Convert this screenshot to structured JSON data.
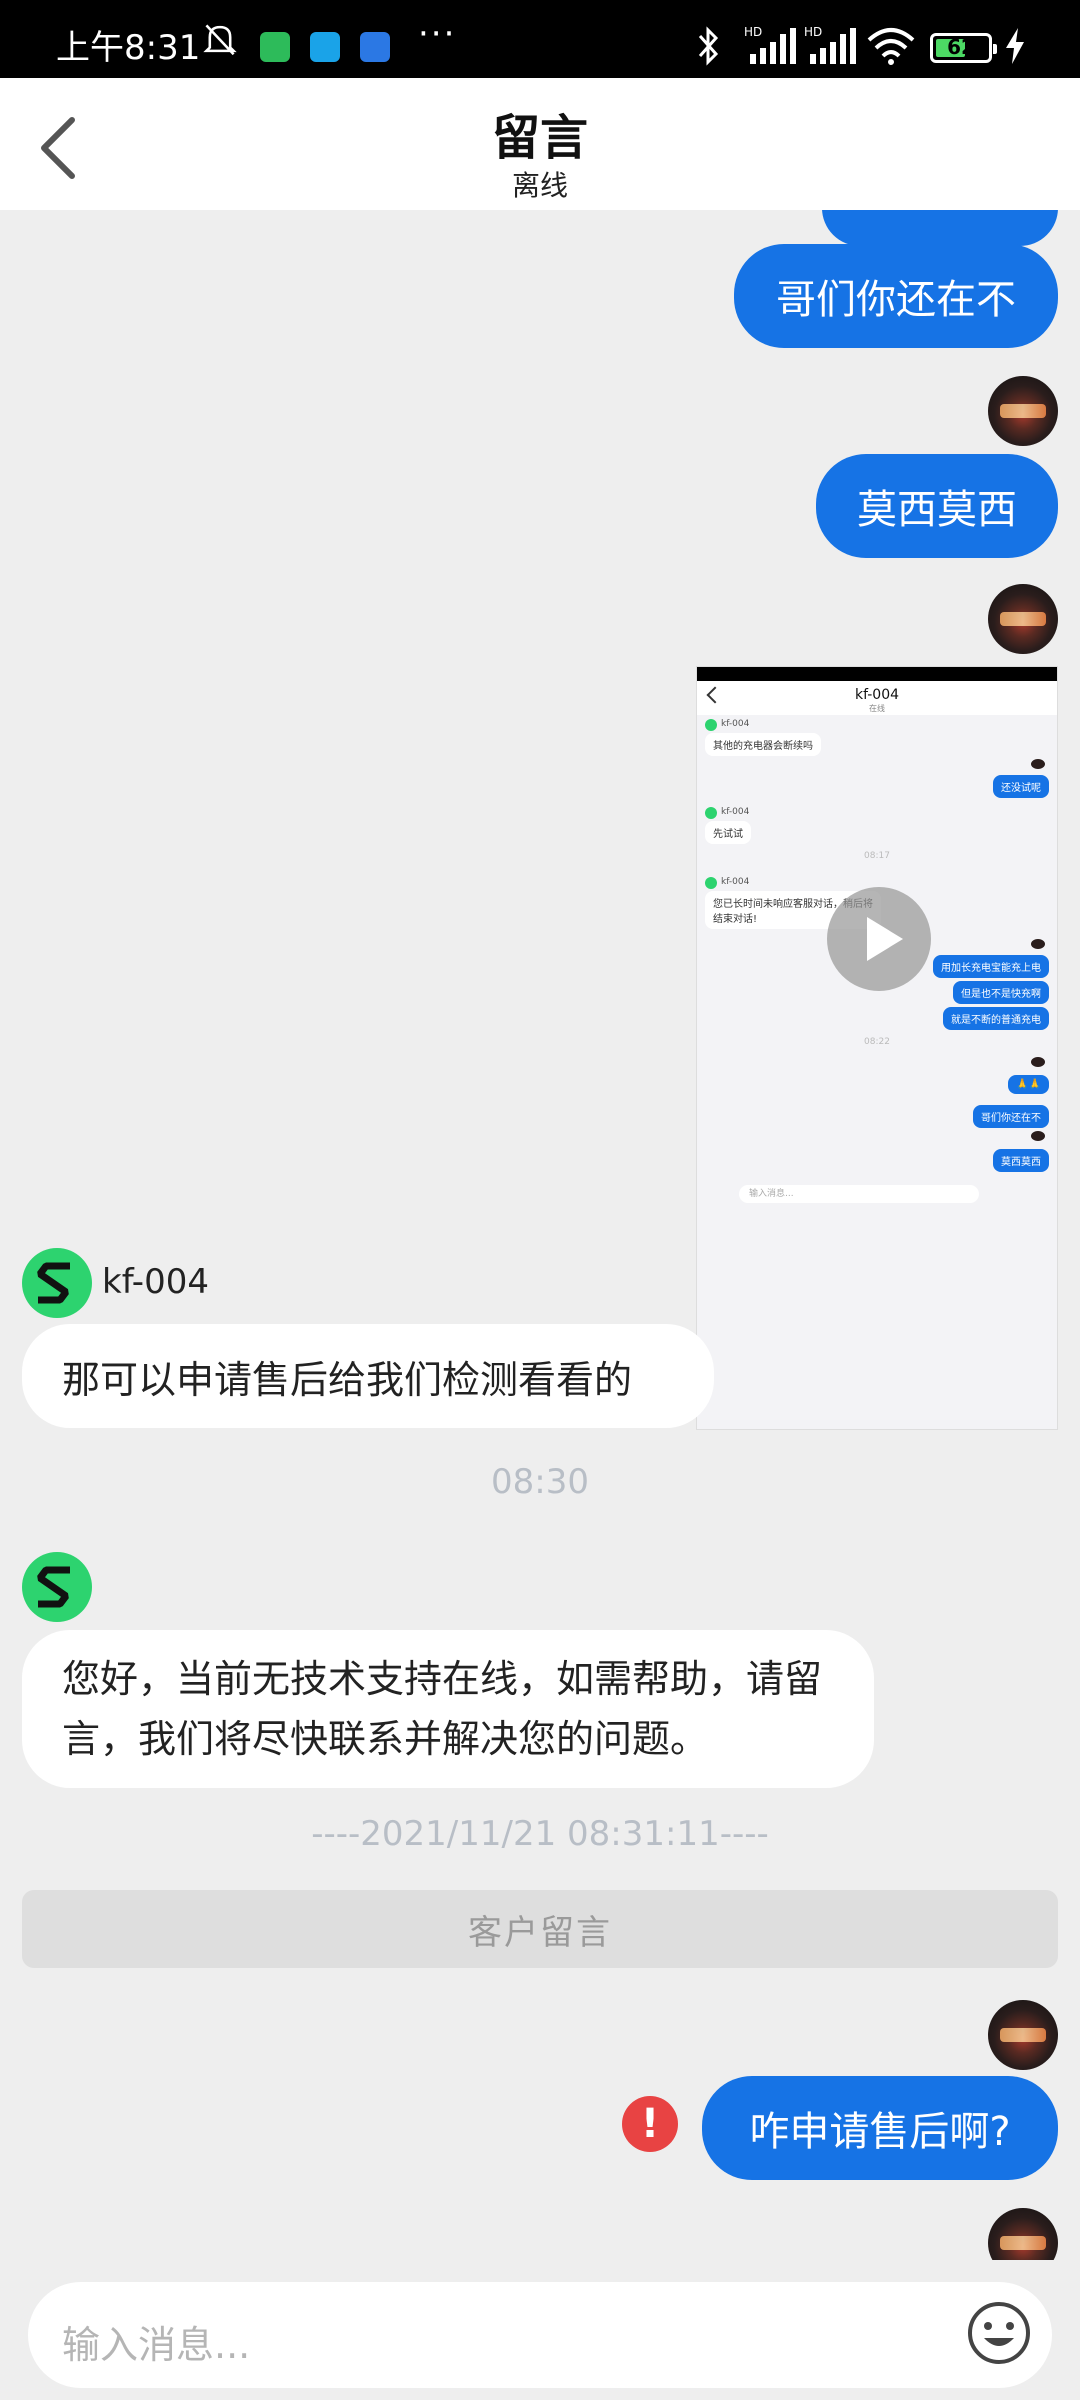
{
  "status_bar": {
    "time": "上午8:31",
    "more": "···",
    "battery": "62",
    "battery_level_percent": 62
  },
  "header": {
    "title": "留言",
    "subtitle": "离线"
  },
  "messages": {
    "out_1": "哥们你还在不",
    "out_2": "莫西莫西",
    "agent_name_1": "kf-004",
    "in_1": "那可以申请售后给我们检测看看的",
    "time_1": "08:30",
    "in_2": "您好，当前无技术支持在线，如需帮助，请留言，我们将尽快联系并解决您的问题。",
    "divider_time": "----2021/11/21 08:31:11----",
    "leave_message_bar": "客户留言",
    "out_3": "咋申请售后啊?",
    "error_mark": "!"
  },
  "video_thumbnail": {
    "title": "kf-004",
    "subtitle": "在线",
    "agent": "kf-004",
    "in_a": "其他的充电器会断续吗",
    "out_a": "还没试呢",
    "in_b": "先试试",
    "ts_a": "08:17",
    "in_c": "您已长时间未响应客服对话，稍后将结束对话!",
    "out_b": "用加长充电宝能充上电",
    "out_c": "但是也不是快充啊",
    "out_d": "就是不断的普通充电",
    "ts_b": "08:22",
    "out_e": "🙏🙏",
    "out_f": "哥们你还在不",
    "out_g": "莫西莫西",
    "input_placeholder": "输入消息..."
  },
  "input": {
    "placeholder": "输入消息..."
  },
  "colors": {
    "bubble_out": "#1673e5",
    "agent_avatar": "#2dd36f",
    "error": "#e84343",
    "background": "#eeeeee"
  },
  "icons": [
    "back-arrow-icon",
    "bluetooth-icon",
    "signal-icon",
    "wifi-icon",
    "battery-icon",
    "charging-icon",
    "play-icon",
    "error-icon",
    "emoji-icon",
    "muted-notification-icon"
  ]
}
